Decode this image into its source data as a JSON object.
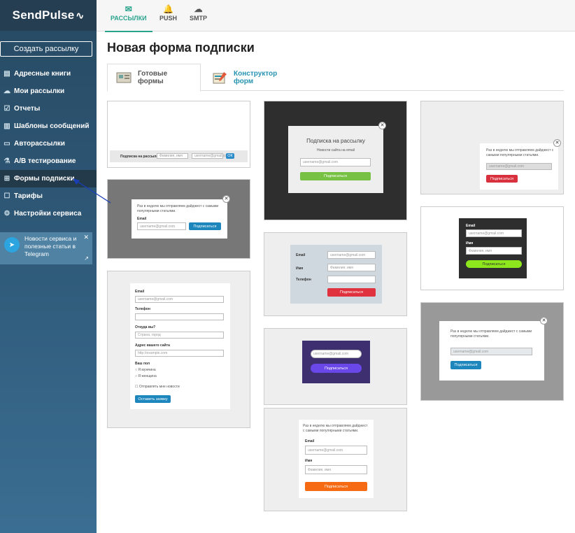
{
  "app": {
    "logo": "SendPulse",
    "logo_mark": "∿"
  },
  "sidebar": {
    "create_button": "Создать рассылку",
    "items": [
      {
        "label": "Адресные книги",
        "icon": "address-book-icon"
      },
      {
        "label": "Мои рассылки",
        "icon": "campaigns-icon"
      },
      {
        "label": "Отчеты",
        "icon": "reports-icon"
      },
      {
        "label": "Шаблоны сообщений",
        "icon": "templates-icon"
      },
      {
        "label": "Авторассылки",
        "icon": "automation-icon"
      },
      {
        "label": "A/B тестирование",
        "icon": "ab-test-icon"
      },
      {
        "label": "Формы подписки",
        "icon": "forms-icon"
      },
      {
        "label": "Тарифы",
        "icon": "pricing-icon"
      },
      {
        "label": "Настройки сервиса",
        "icon": "settings-icon"
      }
    ],
    "telegram": {
      "text": "Новости сервиса и полезные статьи в Telegram"
    }
  },
  "topnav": {
    "tabs": [
      {
        "label": "РАССЫЛКИ",
        "icon": "mail-icon"
      },
      {
        "label": "PUSH",
        "icon": "bell-icon"
      },
      {
        "label": "SMTP",
        "icon": "cloud-icon"
      }
    ]
  },
  "page": {
    "title": "Новая форма подписки",
    "tabs": [
      {
        "label": "Готовые формы"
      },
      {
        "label": "Конструктор форм"
      }
    ]
  },
  "previews": {
    "c1": {
      "label": "Подписка на рассылку",
      "f1": "Фамилия, имя",
      "f2": "username@gmail.com",
      "btn": "ОК"
    },
    "c2": {
      "text": "Раз в неделю мы отправляем дайджест с самыми популярными статьями.",
      "lbl": "Email",
      "f1": "username@gmail.com",
      "btn": "Подписаться"
    },
    "c3": {
      "l1": "Email",
      "f1": "username@gmail.com",
      "l2": "Телефон",
      "l3": "Откуда вы?",
      "f3": "Страна, город",
      "l4": "Адрес вашего сайта",
      "f4": "http://example.com",
      "l5": "Ваш пол",
      "r1": "Я мужчина",
      "r2": "Я женщина",
      "cb": "Отправлять мне новости",
      "btn": "Оставить заявку"
    },
    "c4": {
      "title": "Подписка на рассылку",
      "sub": "Новости сайта на email",
      "f1": "username@gmail.com",
      "btn": "Подписаться"
    },
    "c5": {
      "l1": "Email",
      "f1": "username@gmail.com",
      "l2": "Имя",
      "f2": "Фамилия, имя",
      "l3": "Телефон",
      "btn": "Подписаться"
    },
    "c6": {
      "f1": "username@gmail.com",
      "btn": "Подписаться"
    },
    "c7": {
      "text": "Раз в неделю мы отправляем дайджест с самыми популярными статьями.",
      "l1": "Email",
      "f1": "username@gmail.com",
      "l2": "Имя",
      "f2": "Фамилия, имя",
      "btn": "Подписаться"
    },
    "c8": {
      "text": "Раз в неделю мы отправляем дайджест с самыми популярными статьями.",
      "f1": "username@gmail.com",
      "btn": "Подписаться"
    },
    "c9": {
      "l1": "Email",
      "f1": "username@gmail.com",
      "l2": "Имя",
      "f2": "Фамилия, имя",
      "btn": "Подписаться"
    },
    "c10": {
      "text": "Раз в неделю мы отправляем дайджест с самыми популярными статьями.",
      "f1": "username@gmail.com",
      "btn": "Подписаться"
    }
  },
  "colors": {
    "accent": "#2aa38d",
    "link": "#2693b3",
    "sidebar": "#2e5776"
  }
}
